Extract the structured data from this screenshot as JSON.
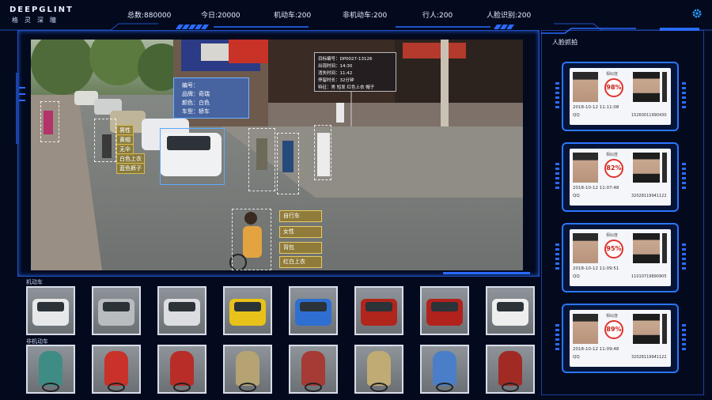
{
  "header": {
    "logo_en": "DEEPGLINT",
    "logo_cn": "格灵深瞳",
    "stats": {
      "total": "总数:880000",
      "today": "今日:20000",
      "motor": "机动车:200",
      "nonmotor": "非机动车:200",
      "pedestrian": "行人:200",
      "face": "人脸识别:200"
    }
  },
  "video": {
    "car_panel": [
      "编号：",
      "品牌：奇瑞",
      "颜色：白色",
      "车型：轿车"
    ],
    "target_panel": [
      "目标编号：DP0027-13126",
      "出现时间：14:30",
      "消失时间：11:42",
      "停留时长：32分钟",
      "特征：男 短发 红色上衣 帽子"
    ],
    "left_tags": [
      "男性",
      "黄帽",
      "无伞",
      "白色上衣",
      "蓝色裤子"
    ],
    "cyclist_tags": [
      "自行车",
      "女性",
      "背包",
      "红白上衣"
    ]
  },
  "motor_row": {
    "label": "机动车",
    "items": [
      "white-van",
      "silver-sedan",
      "white-sedan",
      "yellow-taxi",
      "blue-truck",
      "red-truck",
      "red-suv",
      "white-suv"
    ],
    "colors": [
      "#e6e8ea",
      "#b8bcbf",
      "#dcdde0",
      "#e8c21a",
      "#2f6fd2",
      "#b0261c",
      "#b2221d",
      "#eeeeef"
    ]
  },
  "nonmotor_row": {
    "label": "非机动车",
    "items": [
      "green-raincoat-rider",
      "red-raincoat-rider",
      "red-raincoat-rider",
      "beige-cyclist",
      "red-raincoat-rider",
      "beige-cyclist",
      "blue-shirt-riders",
      "red-raincoat-rider"
    ],
    "colors": [
      "#3f8c85",
      "#c8322a",
      "#b82d28",
      "#b5a374",
      "#a63a34",
      "#c0ab74",
      "#4b7ec8",
      "#a12a25"
    ]
  },
  "right_panel": {
    "title": "人脸抓拍",
    "cards": [
      {
        "similarity_label": "相似度",
        "score": "98%",
        "time": "2018-10-12 11:11:08",
        "site": "QQ",
        "id": "15260011990430"
      },
      {
        "similarity_label": "相似度",
        "score": "82%",
        "time": "2018-10-12 11:07:48",
        "site": "QQ",
        "id": "32028119941122"
      },
      {
        "similarity_label": "相似度",
        "score": "95%",
        "time": "2018-10-12 11:09:51",
        "site": "QQ",
        "id": "11010719890905"
      },
      {
        "similarity_label": "相似度",
        "score": "89%",
        "time": "2018-10-12 11:09:48",
        "site": "QQ",
        "id": "32028119941122"
      }
    ]
  },
  "colors": {
    "accent": "#2a76ff",
    "background": "#040a1e",
    "tag_gold": "#c8a64a",
    "score_red": "#e0332c"
  }
}
